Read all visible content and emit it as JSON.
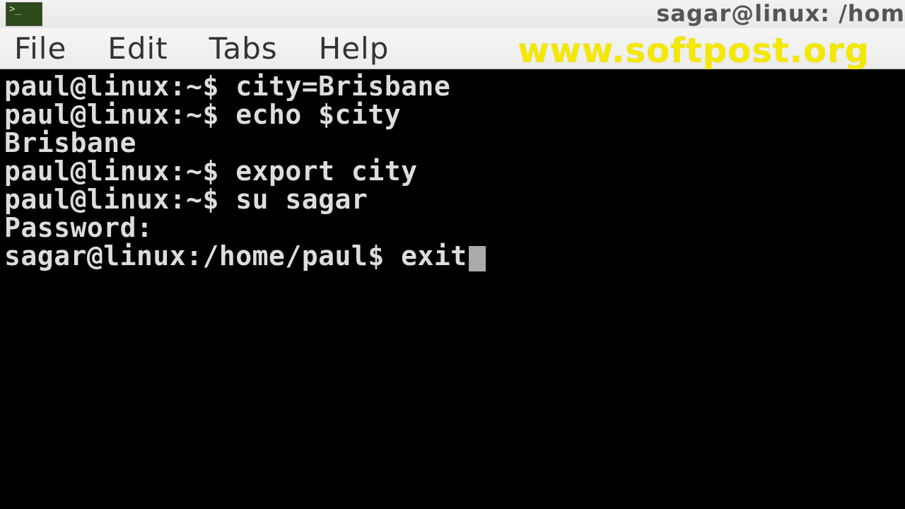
{
  "window": {
    "title": "sagar@linux: /hom",
    "app_icon_text": ">_"
  },
  "menu": {
    "file": "File",
    "edit": "Edit",
    "tabs": "Tabs",
    "help": "Help"
  },
  "watermark": "www.softpost.org",
  "terminal": {
    "lines": [
      {
        "prompt": "paul@linux:~$ ",
        "cmd": "city=Brisbane"
      },
      {
        "prompt": "paul@linux:~$ ",
        "cmd": "echo $city"
      },
      {
        "output": "Brisbane"
      },
      {
        "prompt": "paul@linux:~$ ",
        "cmd": "export city"
      },
      {
        "prompt": "paul@linux:~$ ",
        "cmd": "su sagar"
      },
      {
        "output": "Password: "
      },
      {
        "prompt": "sagar@linux:/home/paul$ ",
        "cmd": "exit",
        "cursor": true
      }
    ]
  }
}
